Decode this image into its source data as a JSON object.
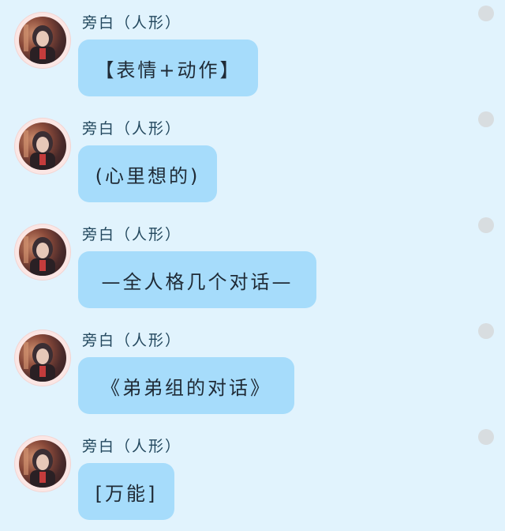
{
  "messages": [
    {
      "sender": "旁白（人形）",
      "text": "【表情+动作】"
    },
    {
      "sender": "旁白（人形）",
      "text": "(心里想的)"
    },
    {
      "sender": "旁白（人形）",
      "text": "—全人格几个对话—"
    },
    {
      "sender": "旁白（人形）",
      "text": "《弟弟组的对话》"
    },
    {
      "sender": "旁白（人形）",
      "text": "[万能]"
    }
  ]
}
